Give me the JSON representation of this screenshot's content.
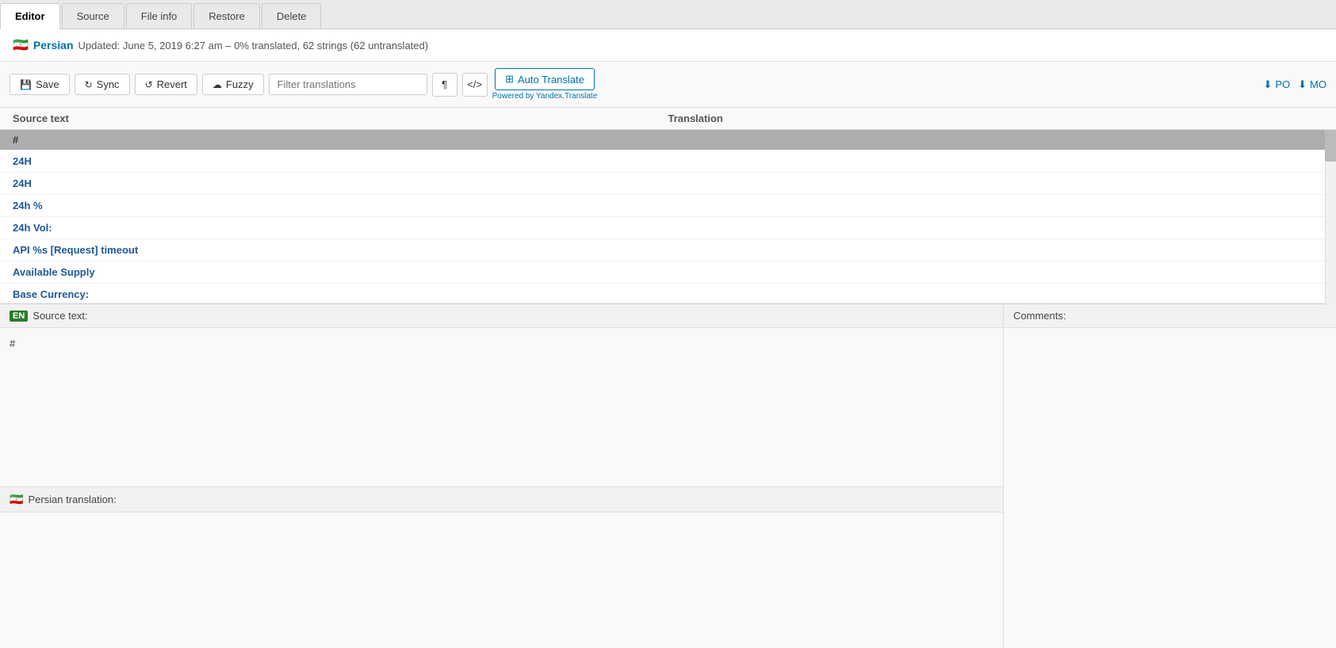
{
  "tabs": [
    {
      "label": "Editor",
      "active": true
    },
    {
      "label": "Source",
      "active": false
    },
    {
      "label": "File info",
      "active": false
    },
    {
      "label": "Restore",
      "active": false
    },
    {
      "label": "Delete",
      "active": false
    }
  ],
  "info": {
    "flag": "🇮🇷",
    "lang": "Persian",
    "meta": "Updated: June 5, 2019 6:27 am – 0% translated, 62 strings (62 untranslated)"
  },
  "toolbar": {
    "save_label": "Save",
    "sync_label": "Sync",
    "revert_label": "Revert",
    "fuzzy_label": "Fuzzy",
    "filter_placeholder": "Filter translations",
    "auto_translate_label": "Auto Translate",
    "powered_by": "Powered by Yandex.Translate",
    "download_po": "PO",
    "download_mo": "MO"
  },
  "table": {
    "source_header": "Source text",
    "translation_header": "Translation"
  },
  "strings": [
    {
      "source": "#",
      "translation": "",
      "selected": true,
      "header": true
    },
    {
      "source": "24H",
      "translation": ""
    },
    {
      "source": "24H",
      "translation": ""
    },
    {
      "source": "24h %",
      "translation": ""
    },
    {
      "source": "24h Vol:",
      "translation": ""
    },
    {
      "source": "API %s [Request] timeout",
      "translation": ""
    },
    {
      "source": "Available Supply",
      "translation": ""
    },
    {
      "source": "Base Currency:",
      "translation": ""
    }
  ],
  "source_panel": {
    "flag": "EN",
    "label": "Source text:",
    "content": "#"
  },
  "comments_panel": {
    "label": "Comments:"
  },
  "translation_panel": {
    "flag": "🇮🇷",
    "label": "Persian translation:"
  }
}
